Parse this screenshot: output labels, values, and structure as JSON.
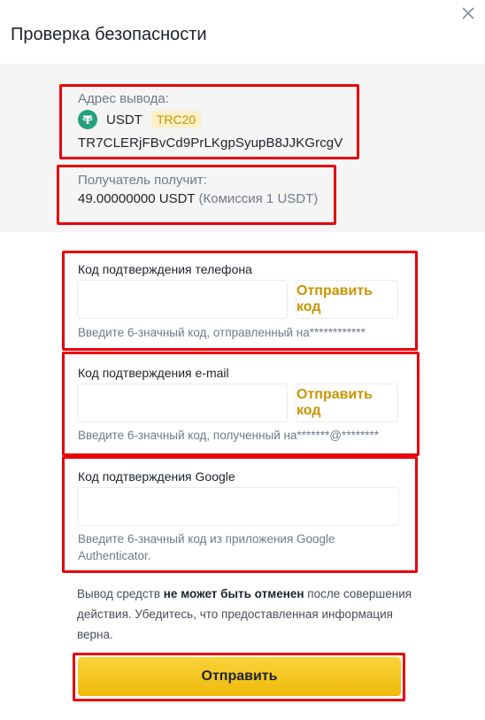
{
  "dialog": {
    "title": "Проверка безопасности"
  },
  "summary": {
    "address_label": "Адрес вывода:",
    "asset": "USDT",
    "network": "TRC20",
    "address": "TR7CLERjFBvCd9PrLKgpSyupB8JJKGrcgV",
    "receive_label": "Получатель получит:",
    "receive_amount": "49.00000000 USDT",
    "receive_fee": "(Комиссия 1 USDT)"
  },
  "phone": {
    "label": "Код подтверждения телефона",
    "value": "",
    "send_code": "Отправить код",
    "hint": "Введите 6-значный код, отправленный на************"
  },
  "email": {
    "label": "Код подтверждения e-mail",
    "value": "",
    "send_code": "Отправить код",
    "hint": "Введите 6-значный код, полученный на*******@********"
  },
  "google": {
    "label": "Код подтверждения Google",
    "value": "",
    "hint": "Введите 6-значный код из приложения Google Authenticator."
  },
  "warning": {
    "part1": "Вывод средств ",
    "bold": "не может быть отменен",
    "part2": " после совершения действия. Убедитесь, что предоставленная информация верна."
  },
  "submit_label": "Отправить",
  "icons": {
    "close": "close-icon",
    "asset": "tether-icon"
  },
  "colors": {
    "accent": "#f0b90b",
    "link": "#c99400",
    "highlight": "#e8000b",
    "muted": "#707a8a"
  }
}
